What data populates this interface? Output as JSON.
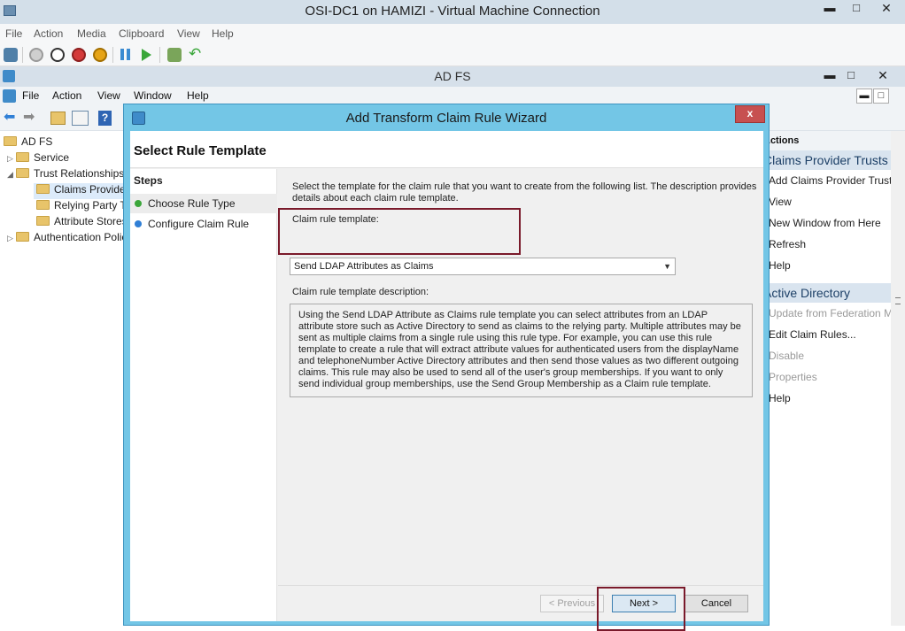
{
  "vm_window": {
    "title": "OSI-DC1 on HAMIZI - Virtual Machine Connection",
    "menu": [
      "File",
      "Action",
      "Media",
      "Clipboard",
      "View",
      "Help"
    ],
    "controls": {
      "minimize": "▬",
      "maximize": "□",
      "close": "✕"
    }
  },
  "mmc_window": {
    "title": "AD FS",
    "menu": [
      "File",
      "Action",
      "View",
      "Window",
      "Help"
    ],
    "tree": {
      "root": "AD FS",
      "service": "Service",
      "trust_relationships": "Trust Relationships",
      "claims_provider": "Claims Provider Trusts",
      "relying_party": "Relying Party Trusts",
      "attribute_stores": "Attribute Stores",
      "authentication_policies": "Authentication Policies"
    },
    "actions": {
      "header": "Actions",
      "section1_title": "Claims Provider Trusts",
      "section1_items": [
        "Add Claims Provider Trust...",
        "View",
        "New Window from Here",
        "Refresh",
        "Help"
      ],
      "section2_title": "Active Directory",
      "section2_items": [
        "Update from Federation Metadata...",
        "Edit Claim Rules...",
        "Disable",
        "Properties",
        "Help"
      ]
    }
  },
  "wizard": {
    "title": "Add Transform Claim Rule Wizard",
    "close": "x",
    "header": "Select Rule Template",
    "steps_title": "Steps",
    "steps": [
      "Choose Rule Type",
      "Configure Claim Rule"
    ],
    "intro_line1": "Select the template for the claim rule that you want to create from the following list. The description provides",
    "intro_line2": "details about each claim rule template.",
    "template_label": "Claim rule template:",
    "template_value": "Send LDAP Attributes as Claims",
    "description_label": "Claim rule template description:",
    "description": "Using the Send LDAP Attribute as Claims rule template you can select attributes from an LDAP attribute store such as Active Directory to send as claims to the relying party. Multiple attributes may be sent as multiple claims from a single rule using this rule type. For example, you can use this rule template to create a rule that will extract attribute values for authenticated users from the displayName and telephoneNumber Active Directory attributes and then send those values as two different outgoing claims. This rule may also be used to send all of the user's group memberships. If you want to only send individual group memberships, use the Send Group Membership as a Claim rule template.",
    "buttons": {
      "previous": "< Previous",
      "next": "Next >",
      "cancel": "Cancel"
    }
  },
  "colors": {
    "wizard_frame": "#73c6e6",
    "highlight_box": "#7a1a2b",
    "close_button": "#c75050",
    "step_active": "#3aa63a",
    "step_pending": "#2f7fd6"
  }
}
